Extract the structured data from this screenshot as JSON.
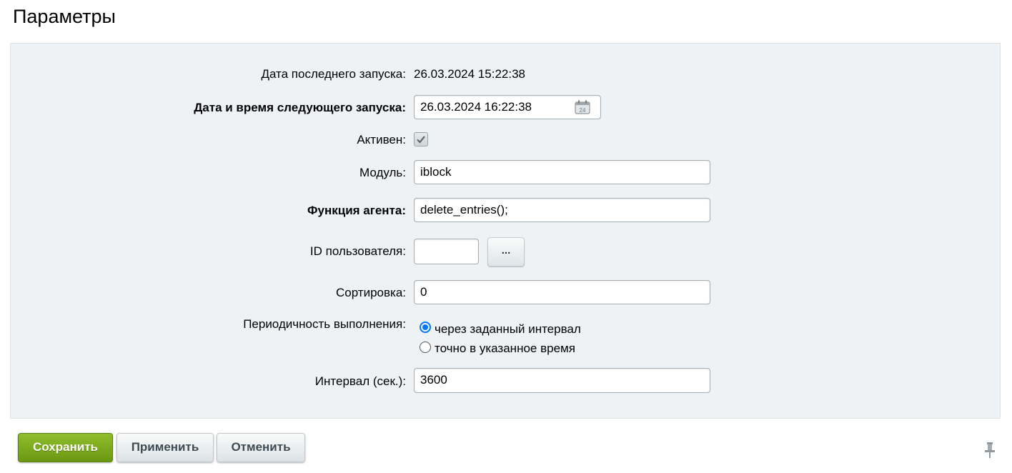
{
  "page": {
    "title": "Параметры"
  },
  "form": {
    "last_run": {
      "label": "Дата последнего запуска:",
      "value": "26.03.2024 15:22:38"
    },
    "next_run": {
      "label": "Дата и время следующего запуска:",
      "value": "26.03.2024 16:22:38",
      "icon": "calendar-icon"
    },
    "active": {
      "label": "Активен:",
      "checked": true
    },
    "module": {
      "label": "Модуль:",
      "value": "iblock"
    },
    "agent_function": {
      "label": "Функция агента:",
      "value": "delete_entries();"
    },
    "user_id": {
      "label": "ID пользователя:",
      "value": "",
      "button_label": "..."
    },
    "sort": {
      "label": "Сортировка:",
      "value": "0"
    },
    "periodicity": {
      "label": "Периодичность выполнения:",
      "options": [
        {
          "label": "через заданный интервал",
          "checked": true
        },
        {
          "label": "точно в указанное время",
          "checked": false
        }
      ]
    },
    "interval": {
      "label": "Интервал (сек.):",
      "value": "3600"
    }
  },
  "buttons": {
    "save": "Сохранить",
    "apply": "Применить",
    "cancel": "Отменить"
  },
  "colors": {
    "panel_bg": "#eef2f4",
    "save_button": "#7aaa1e",
    "radio_accent": "#0075ff"
  }
}
